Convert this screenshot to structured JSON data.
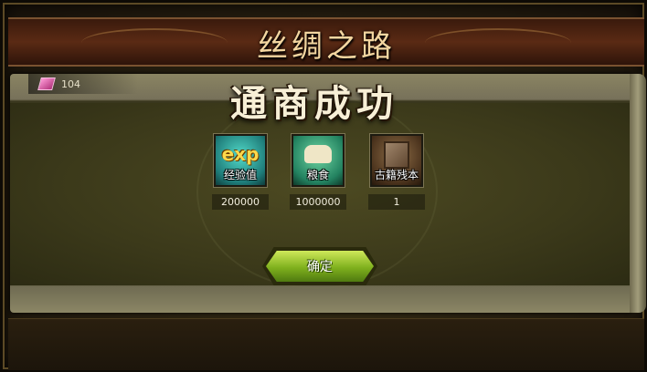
{
  "window": {
    "title": "丝绸之路"
  },
  "counter": {
    "icon": "gem-icon",
    "value": "104"
  },
  "result": {
    "heading": "通商成功"
  },
  "rewards": [
    {
      "icon": "exp-icon",
      "icon_text": "exp",
      "label": "经验值",
      "amount": "200000"
    },
    {
      "icon": "food-sack-icon",
      "label": "粮食",
      "amount": "1000000"
    },
    {
      "icon": "ancient-book-icon",
      "label": "古籍残本",
      "amount": "1"
    }
  ],
  "buttons": {
    "confirm_label": "确定"
  }
}
